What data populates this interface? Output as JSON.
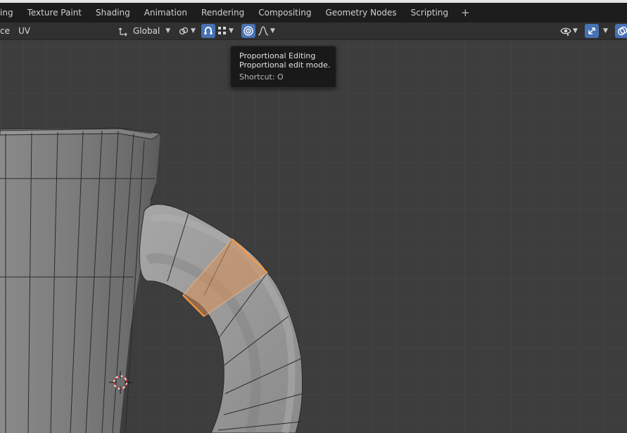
{
  "workspace_tabs": [
    "ing",
    "Texture Paint",
    "Shading",
    "Animation",
    "Rendering",
    "Compositing",
    "Geometry Nodes",
    "Scripting"
  ],
  "add_tab_label": "+",
  "header": {
    "menu_left_1": "ce",
    "menu_left_2": "UV",
    "transform_orientation": "Global"
  },
  "tooltip": {
    "title": "Proportional Editing",
    "description": "Proportional edit mode.",
    "shortcut": "Shortcut: O"
  },
  "colors": {
    "accent": "#4772b3",
    "selection": "#ff9a3c",
    "background": "#3d3d3d"
  },
  "icons": [
    "pivot-icon",
    "link-icon",
    "snap-icon",
    "snap-target-icon",
    "proportional-editing-icon",
    "falloff-curve-icon",
    "visibility-icon",
    "gizmo-icon",
    "overlay-icon",
    "3d-cursor-icon"
  ]
}
